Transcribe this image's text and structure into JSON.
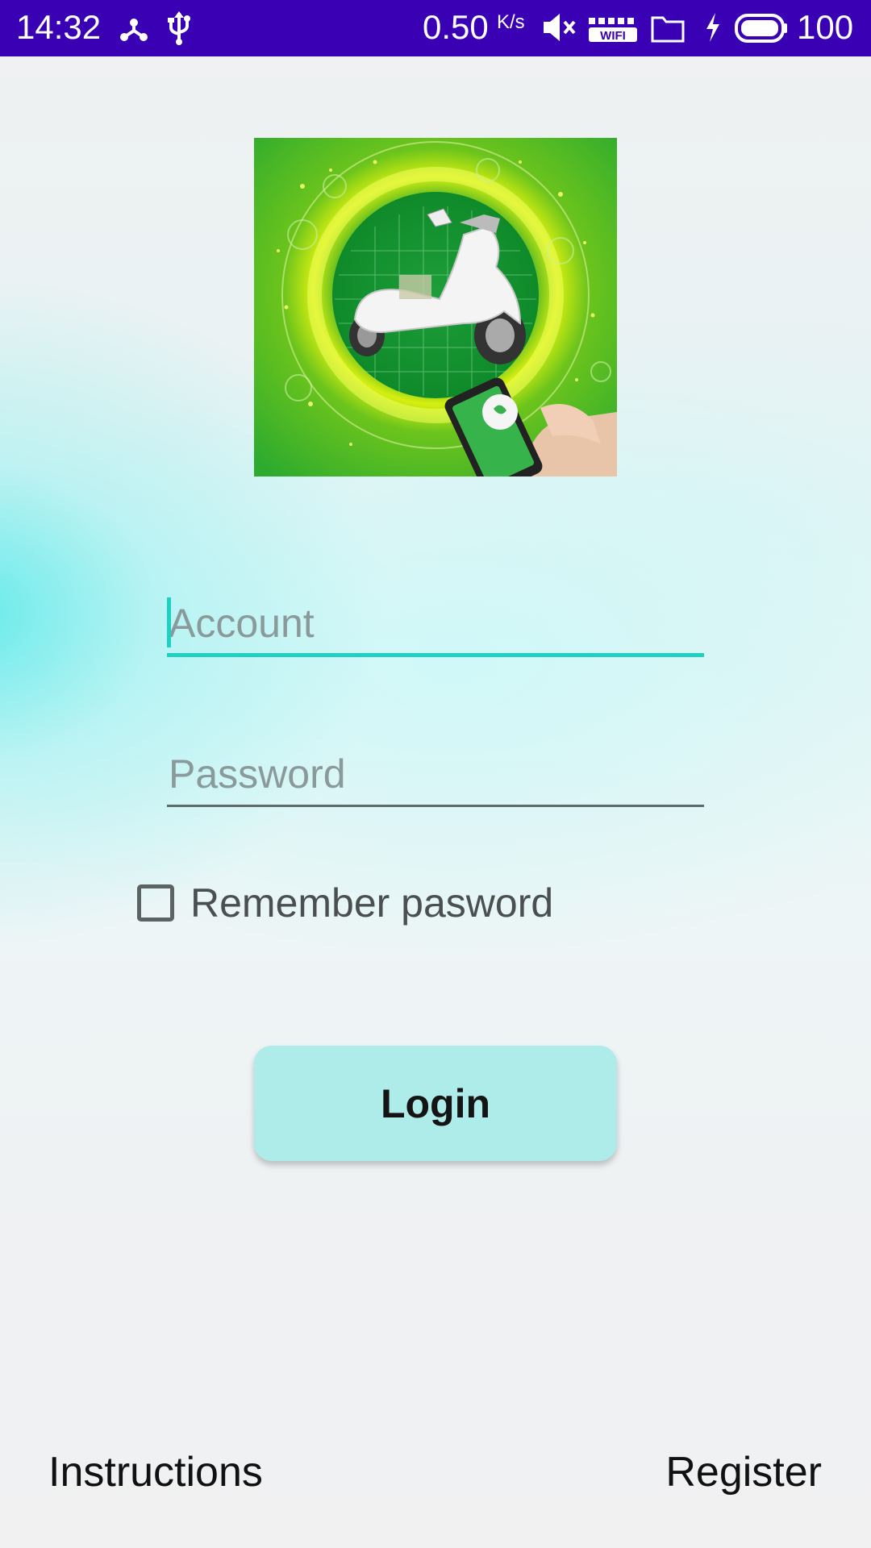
{
  "status_bar": {
    "time": "14:32",
    "network_speed": "0.50",
    "network_speed_unit": "K/s",
    "battery_percent": "100",
    "background_color": "#3a00b4",
    "icons": [
      "network-share-icon",
      "usb-icon",
      "mute-icon",
      "wifi-icon",
      "folder-icon",
      "charging-icon",
      "battery-icon"
    ]
  },
  "logo": {
    "icon": "scooter-logo-icon",
    "colors": {
      "background": "#2eb52e",
      "glow": "#e8f000"
    }
  },
  "form": {
    "account": {
      "placeholder": "Account",
      "value": "",
      "accent_color": "#1fd1c1"
    },
    "password": {
      "placeholder": "Password",
      "value": ""
    },
    "remember": {
      "label": "Remember pasword",
      "checked": false
    },
    "login_label": "Login",
    "login_button_color": "#aeecea"
  },
  "footer": {
    "instructions_label": "Instructions",
    "register_label": "Register"
  }
}
